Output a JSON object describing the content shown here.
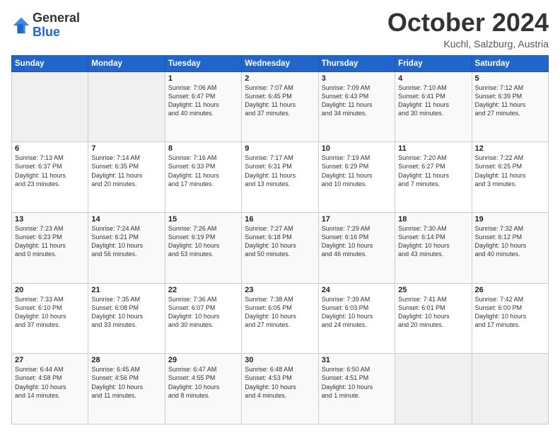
{
  "header": {
    "logo_general": "General",
    "logo_blue": "Blue",
    "month": "October 2024",
    "location": "Kuchl, Salzburg, Austria"
  },
  "days_of_week": [
    "Sunday",
    "Monday",
    "Tuesday",
    "Wednesday",
    "Thursday",
    "Friday",
    "Saturday"
  ],
  "weeks": [
    [
      {
        "day": "",
        "info": ""
      },
      {
        "day": "",
        "info": ""
      },
      {
        "day": "1",
        "info": "Sunrise: 7:06 AM\nSunset: 6:47 PM\nDaylight: 11 hours\nand 40 minutes."
      },
      {
        "day": "2",
        "info": "Sunrise: 7:07 AM\nSunset: 6:45 PM\nDaylight: 11 hours\nand 37 minutes."
      },
      {
        "day": "3",
        "info": "Sunrise: 7:09 AM\nSunset: 6:43 PM\nDaylight: 11 hours\nand 34 minutes."
      },
      {
        "day": "4",
        "info": "Sunrise: 7:10 AM\nSunset: 6:41 PM\nDaylight: 11 hours\nand 30 minutes."
      },
      {
        "day": "5",
        "info": "Sunrise: 7:12 AM\nSunset: 6:39 PM\nDaylight: 11 hours\nand 27 minutes."
      }
    ],
    [
      {
        "day": "6",
        "info": "Sunrise: 7:13 AM\nSunset: 6:37 PM\nDaylight: 11 hours\nand 23 minutes."
      },
      {
        "day": "7",
        "info": "Sunrise: 7:14 AM\nSunset: 6:35 PM\nDaylight: 11 hours\nand 20 minutes."
      },
      {
        "day": "8",
        "info": "Sunrise: 7:16 AM\nSunset: 6:33 PM\nDaylight: 11 hours\nand 17 minutes."
      },
      {
        "day": "9",
        "info": "Sunrise: 7:17 AM\nSunset: 6:31 PM\nDaylight: 11 hours\nand 13 minutes."
      },
      {
        "day": "10",
        "info": "Sunrise: 7:19 AM\nSunset: 6:29 PM\nDaylight: 11 hours\nand 10 minutes."
      },
      {
        "day": "11",
        "info": "Sunrise: 7:20 AM\nSunset: 6:27 PM\nDaylight: 11 hours\nand 7 minutes."
      },
      {
        "day": "12",
        "info": "Sunrise: 7:22 AM\nSunset: 6:25 PM\nDaylight: 11 hours\nand 3 minutes."
      }
    ],
    [
      {
        "day": "13",
        "info": "Sunrise: 7:23 AM\nSunset: 6:23 PM\nDaylight: 11 hours\nand 0 minutes."
      },
      {
        "day": "14",
        "info": "Sunrise: 7:24 AM\nSunset: 6:21 PM\nDaylight: 10 hours\nand 56 minutes."
      },
      {
        "day": "15",
        "info": "Sunrise: 7:26 AM\nSunset: 6:19 PM\nDaylight: 10 hours\nand 53 minutes."
      },
      {
        "day": "16",
        "info": "Sunrise: 7:27 AM\nSunset: 6:18 PM\nDaylight: 10 hours\nand 50 minutes."
      },
      {
        "day": "17",
        "info": "Sunrise: 7:29 AM\nSunset: 6:16 PM\nDaylight: 10 hours\nand 46 minutes."
      },
      {
        "day": "18",
        "info": "Sunrise: 7:30 AM\nSunset: 6:14 PM\nDaylight: 10 hours\nand 43 minutes."
      },
      {
        "day": "19",
        "info": "Sunrise: 7:32 AM\nSunset: 6:12 PM\nDaylight: 10 hours\nand 40 minutes."
      }
    ],
    [
      {
        "day": "20",
        "info": "Sunrise: 7:33 AM\nSunset: 6:10 PM\nDaylight: 10 hours\nand 37 minutes."
      },
      {
        "day": "21",
        "info": "Sunrise: 7:35 AM\nSunset: 6:08 PM\nDaylight: 10 hours\nand 33 minutes."
      },
      {
        "day": "22",
        "info": "Sunrise: 7:36 AM\nSunset: 6:07 PM\nDaylight: 10 hours\nand 30 minutes."
      },
      {
        "day": "23",
        "info": "Sunrise: 7:38 AM\nSunset: 6:05 PM\nDaylight: 10 hours\nand 27 minutes."
      },
      {
        "day": "24",
        "info": "Sunrise: 7:39 AM\nSunset: 6:03 PM\nDaylight: 10 hours\nand 24 minutes."
      },
      {
        "day": "25",
        "info": "Sunrise: 7:41 AM\nSunset: 6:01 PM\nDaylight: 10 hours\nand 20 minutes."
      },
      {
        "day": "26",
        "info": "Sunrise: 7:42 AM\nSunset: 6:00 PM\nDaylight: 10 hours\nand 17 minutes."
      }
    ],
    [
      {
        "day": "27",
        "info": "Sunrise: 6:44 AM\nSunset: 4:58 PM\nDaylight: 10 hours\nand 14 minutes."
      },
      {
        "day": "28",
        "info": "Sunrise: 6:45 AM\nSunset: 4:56 PM\nDaylight: 10 hours\nand 11 minutes."
      },
      {
        "day": "29",
        "info": "Sunrise: 6:47 AM\nSunset: 4:55 PM\nDaylight: 10 hours\nand 8 minutes."
      },
      {
        "day": "30",
        "info": "Sunrise: 6:48 AM\nSunset: 4:53 PM\nDaylight: 10 hours\nand 4 minutes."
      },
      {
        "day": "31",
        "info": "Sunrise: 6:50 AM\nSunset: 4:51 PM\nDaylight: 10 hours\nand 1 minute."
      },
      {
        "day": "",
        "info": ""
      },
      {
        "day": "",
        "info": ""
      }
    ]
  ]
}
